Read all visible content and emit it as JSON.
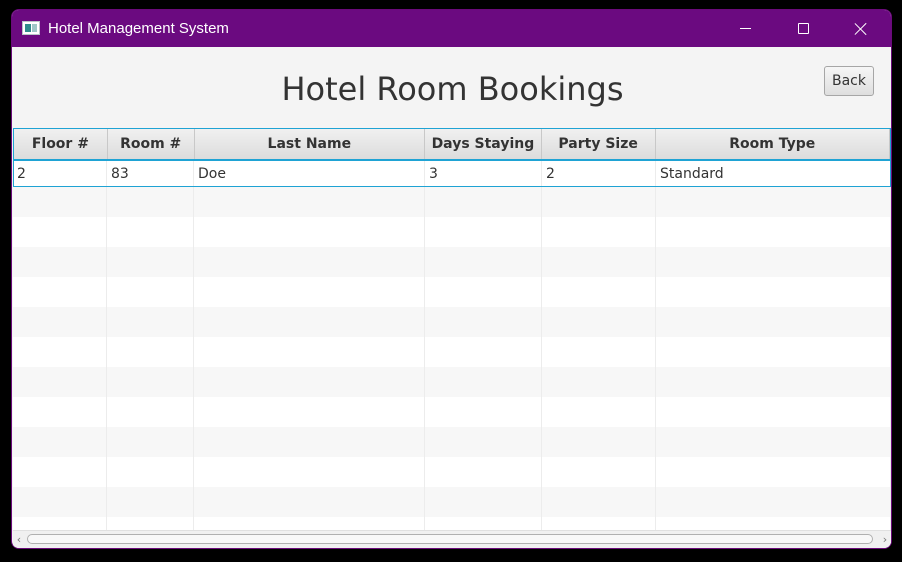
{
  "window": {
    "title": "Hotel Management System",
    "title_bar_color": "#6b0a80",
    "app_icon": "app-window-icon",
    "controls": {
      "minimize_icon": "minimize-icon",
      "maximize_icon": "maximize-icon",
      "close_icon": "close-icon"
    }
  },
  "page": {
    "heading": "Hotel Room Bookings",
    "back_label": "Back"
  },
  "table": {
    "columns": [
      "Floor #",
      "Room #",
      "Last Name",
      "Days Staying",
      "Party Size",
      "Room Type"
    ],
    "rows": [
      [
        "2",
        "83",
        "Doe",
        "3",
        "2",
        "Standard"
      ]
    ],
    "selected_row": 0,
    "selection_color": "#1fa3d4"
  },
  "scrollbar": {
    "left_arrow": "‹",
    "right_arrow": "›"
  }
}
